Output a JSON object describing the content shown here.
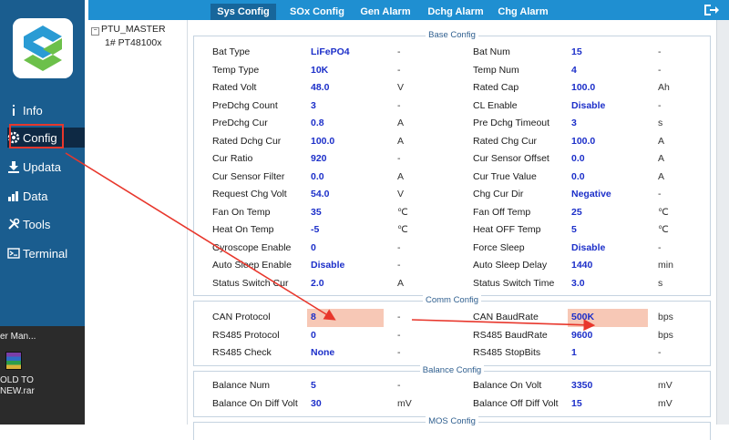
{
  "sidebar": {
    "items": [
      {
        "name": "info",
        "label": "Info",
        "icon": "info-icon"
      },
      {
        "name": "config",
        "label": "Config",
        "icon": "gear-icon"
      },
      {
        "name": "update",
        "label": "Updata",
        "icon": "download-icon"
      },
      {
        "name": "data",
        "label": "Data",
        "icon": "bar-chart-icon"
      },
      {
        "name": "tools",
        "label": "Tools",
        "icon": "tools-icon"
      },
      {
        "name": "terminal",
        "label": "Terminal",
        "icon": "terminal-icon"
      }
    ],
    "active": "Config"
  },
  "desktop": {
    "line1": "er Man...",
    "line2": "OLD TO",
    "line3": "NEW.rar"
  },
  "tree": {
    "root": "PTU_MASTER",
    "child": "1# PT48100x"
  },
  "tabs": [
    "Sys Config",
    "SOx Config",
    "Gen Alarm",
    "Dchg Alarm",
    "Chg Alarm"
  ],
  "active_tab": "Sys Config",
  "sections": {
    "base": {
      "title": "Base Config",
      "rows": [
        [
          {
            "l": "Bat Type",
            "v": "LiFePO4",
            "u": "-"
          },
          {
            "l": "Bat Num",
            "v": "15",
            "u": "-"
          }
        ],
        [
          {
            "l": "Temp Type",
            "v": "10K",
            "u": "-"
          },
          {
            "l": "Temp Num",
            "v": "4",
            "u": "-"
          }
        ],
        [
          {
            "l": "Rated Volt",
            "v": "48.0",
            "u": "V"
          },
          {
            "l": "Rated Cap",
            "v": "100.0",
            "u": "Ah"
          }
        ],
        [
          {
            "l": "PreDchg Count",
            "v": "3",
            "u": "-"
          },
          {
            "l": "CL Enable",
            "v": "Disable",
            "u": "-"
          }
        ],
        [
          {
            "l": "PreDchg Cur",
            "v": "0.8",
            "u": "A"
          },
          {
            "l": "Pre Dchg Timeout",
            "v": "3",
            "u": "s"
          }
        ],
        [
          {
            "l": "Rated Dchg Cur",
            "v": "100.0",
            "u": "A"
          },
          {
            "l": "Rated Chg Cur",
            "v": "100.0",
            "u": "A"
          }
        ],
        [
          {
            "l": "Cur Ratio",
            "v": "920",
            "u": "-"
          },
          {
            "l": "Cur Sensor Offset",
            "v": "0.0",
            "u": "A"
          }
        ],
        [
          {
            "l": "Cur Sensor Filter",
            "v": "0.0",
            "u": "A"
          },
          {
            "l": "Cur True Value",
            "v": "0.0",
            "u": "A"
          }
        ],
        [
          {
            "l": "Request Chg Volt",
            "v": "54.0",
            "u": "V"
          },
          {
            "l": "Chg Cur Dir",
            "v": "Negative",
            "u": "-"
          }
        ],
        [
          {
            "l": "Fan On Temp",
            "v": "35",
            "u": "℃"
          },
          {
            "l": "Fan Off Temp",
            "v": "25",
            "u": "℃"
          }
        ],
        [
          {
            "l": "Heat On Temp",
            "v": "-5",
            "u": "℃"
          },
          {
            "l": "Heat OFF Temp",
            "v": "5",
            "u": "℃"
          }
        ],
        [
          {
            "l": "Gyroscope Enable",
            "v": "0",
            "u": "-"
          },
          {
            "l": "Force Sleep",
            "v": "Disable",
            "u": "-"
          }
        ],
        [
          {
            "l": "Auto Sleep Enable",
            "v": "Disable",
            "u": "-"
          },
          {
            "l": "Auto Sleep Delay",
            "v": "1440",
            "u": "min"
          }
        ],
        [
          {
            "l": "Status Switch Cur",
            "v": "2.0",
            "u": "A"
          },
          {
            "l": "Status Switch Time",
            "v": "3.0",
            "u": "s"
          }
        ]
      ]
    },
    "comm": {
      "title": "Comm Config",
      "rows": [
        [
          {
            "l": "CAN Protocol",
            "v": "8",
            "u": "-",
            "hl": true
          },
          {
            "l": "CAN BaudRate",
            "v": "500K",
            "u": "bps",
            "hl": true
          }
        ],
        [
          {
            "l": "RS485 Protocol",
            "v": "0",
            "u": "-"
          },
          {
            "l": "RS485 BaudRate",
            "v": "9600",
            "u": "bps"
          }
        ],
        [
          {
            "l": "RS485 Check",
            "v": "None",
            "u": "-"
          },
          {
            "l": "RS485 StopBits",
            "v": "1",
            "u": "-"
          }
        ]
      ]
    },
    "balance": {
      "title": "Balance Config",
      "rows": [
        [
          {
            "l": "Balance Num",
            "v": "5",
            "u": "-"
          },
          {
            "l": "Balance On Volt",
            "v": "3350",
            "u": "mV"
          }
        ],
        [
          {
            "l": "Balance On Diff Volt",
            "v": "30",
            "u": "mV"
          },
          {
            "l": "Balance Off Diff Volt",
            "v": "15",
            "u": "mV"
          }
        ]
      ]
    },
    "mos": {
      "title": "MOS Config"
    }
  },
  "colors": {
    "sidebar": "#1a5d8f",
    "tabbar": "#1f8fd1",
    "value": "#1c2fc9",
    "highlight": "#f7c8b6",
    "annotation": "#e8372c"
  }
}
